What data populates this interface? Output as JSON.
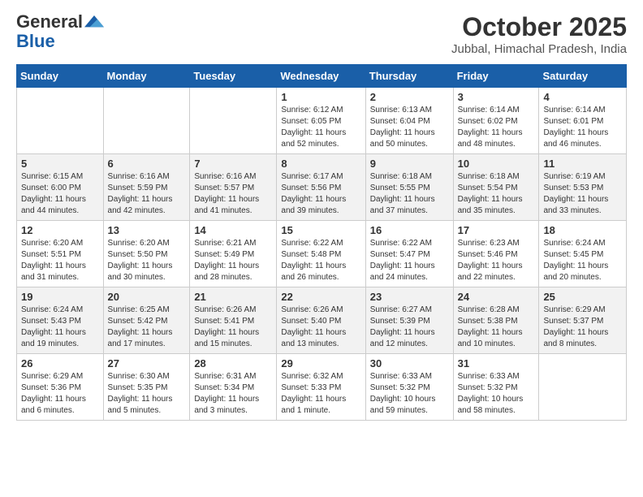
{
  "header": {
    "logo_general": "General",
    "logo_blue": "Blue",
    "month_title": "October 2025",
    "location": "Jubbal, Himachal Pradesh, India"
  },
  "days_of_week": [
    "Sunday",
    "Monday",
    "Tuesday",
    "Wednesday",
    "Thursday",
    "Friday",
    "Saturday"
  ],
  "weeks": [
    [
      {
        "day": "",
        "info": ""
      },
      {
        "day": "",
        "info": ""
      },
      {
        "day": "",
        "info": ""
      },
      {
        "day": "1",
        "info": "Sunrise: 6:12 AM\nSunset: 6:05 PM\nDaylight: 11 hours\nand 52 minutes."
      },
      {
        "day": "2",
        "info": "Sunrise: 6:13 AM\nSunset: 6:04 PM\nDaylight: 11 hours\nand 50 minutes."
      },
      {
        "day": "3",
        "info": "Sunrise: 6:14 AM\nSunset: 6:02 PM\nDaylight: 11 hours\nand 48 minutes."
      },
      {
        "day": "4",
        "info": "Sunrise: 6:14 AM\nSunset: 6:01 PM\nDaylight: 11 hours\nand 46 minutes."
      }
    ],
    [
      {
        "day": "5",
        "info": "Sunrise: 6:15 AM\nSunset: 6:00 PM\nDaylight: 11 hours\nand 44 minutes."
      },
      {
        "day": "6",
        "info": "Sunrise: 6:16 AM\nSunset: 5:59 PM\nDaylight: 11 hours\nand 42 minutes."
      },
      {
        "day": "7",
        "info": "Sunrise: 6:16 AM\nSunset: 5:57 PM\nDaylight: 11 hours\nand 41 minutes."
      },
      {
        "day": "8",
        "info": "Sunrise: 6:17 AM\nSunset: 5:56 PM\nDaylight: 11 hours\nand 39 minutes."
      },
      {
        "day": "9",
        "info": "Sunrise: 6:18 AM\nSunset: 5:55 PM\nDaylight: 11 hours\nand 37 minutes."
      },
      {
        "day": "10",
        "info": "Sunrise: 6:18 AM\nSunset: 5:54 PM\nDaylight: 11 hours\nand 35 minutes."
      },
      {
        "day": "11",
        "info": "Sunrise: 6:19 AM\nSunset: 5:53 PM\nDaylight: 11 hours\nand 33 minutes."
      }
    ],
    [
      {
        "day": "12",
        "info": "Sunrise: 6:20 AM\nSunset: 5:51 PM\nDaylight: 11 hours\nand 31 minutes."
      },
      {
        "day": "13",
        "info": "Sunrise: 6:20 AM\nSunset: 5:50 PM\nDaylight: 11 hours\nand 30 minutes."
      },
      {
        "day": "14",
        "info": "Sunrise: 6:21 AM\nSunset: 5:49 PM\nDaylight: 11 hours\nand 28 minutes."
      },
      {
        "day": "15",
        "info": "Sunrise: 6:22 AM\nSunset: 5:48 PM\nDaylight: 11 hours\nand 26 minutes."
      },
      {
        "day": "16",
        "info": "Sunrise: 6:22 AM\nSunset: 5:47 PM\nDaylight: 11 hours\nand 24 minutes."
      },
      {
        "day": "17",
        "info": "Sunrise: 6:23 AM\nSunset: 5:46 PM\nDaylight: 11 hours\nand 22 minutes."
      },
      {
        "day": "18",
        "info": "Sunrise: 6:24 AM\nSunset: 5:45 PM\nDaylight: 11 hours\nand 20 minutes."
      }
    ],
    [
      {
        "day": "19",
        "info": "Sunrise: 6:24 AM\nSunset: 5:43 PM\nDaylight: 11 hours\nand 19 minutes."
      },
      {
        "day": "20",
        "info": "Sunrise: 6:25 AM\nSunset: 5:42 PM\nDaylight: 11 hours\nand 17 minutes."
      },
      {
        "day": "21",
        "info": "Sunrise: 6:26 AM\nSunset: 5:41 PM\nDaylight: 11 hours\nand 15 minutes."
      },
      {
        "day": "22",
        "info": "Sunrise: 6:26 AM\nSunset: 5:40 PM\nDaylight: 11 hours\nand 13 minutes."
      },
      {
        "day": "23",
        "info": "Sunrise: 6:27 AM\nSunset: 5:39 PM\nDaylight: 11 hours\nand 12 minutes."
      },
      {
        "day": "24",
        "info": "Sunrise: 6:28 AM\nSunset: 5:38 PM\nDaylight: 11 hours\nand 10 minutes."
      },
      {
        "day": "25",
        "info": "Sunrise: 6:29 AM\nSunset: 5:37 PM\nDaylight: 11 hours\nand 8 minutes."
      }
    ],
    [
      {
        "day": "26",
        "info": "Sunrise: 6:29 AM\nSunset: 5:36 PM\nDaylight: 11 hours\nand 6 minutes."
      },
      {
        "day": "27",
        "info": "Sunrise: 6:30 AM\nSunset: 5:35 PM\nDaylight: 11 hours\nand 5 minutes."
      },
      {
        "day": "28",
        "info": "Sunrise: 6:31 AM\nSunset: 5:34 PM\nDaylight: 11 hours\nand 3 minutes."
      },
      {
        "day": "29",
        "info": "Sunrise: 6:32 AM\nSunset: 5:33 PM\nDaylight: 11 hours\nand 1 minute."
      },
      {
        "day": "30",
        "info": "Sunrise: 6:33 AM\nSunset: 5:32 PM\nDaylight: 10 hours\nand 59 minutes."
      },
      {
        "day": "31",
        "info": "Sunrise: 6:33 AM\nSunset: 5:32 PM\nDaylight: 10 hours\nand 58 minutes."
      },
      {
        "day": "",
        "info": ""
      }
    ]
  ]
}
